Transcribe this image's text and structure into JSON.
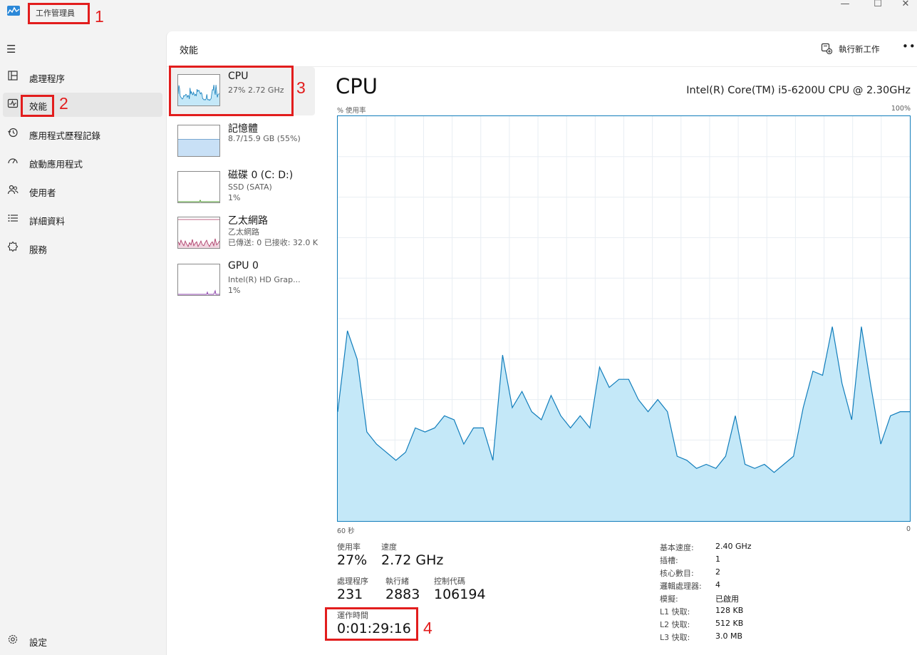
{
  "app": {
    "title": "工作管理員"
  },
  "window_controls": {
    "minimize": "—",
    "maximize": "☐",
    "close": "✕"
  },
  "nav": {
    "items": [
      {
        "label": "處理程序",
        "icon": "processes-icon",
        "active": false
      },
      {
        "label": "效能",
        "icon": "performance-icon",
        "active": true
      },
      {
        "label": "應用程式歷程記錄",
        "icon": "app-history-icon",
        "active": false
      },
      {
        "label": "啟動應用程式",
        "icon": "startup-apps-icon",
        "active": false
      },
      {
        "label": "使用者",
        "icon": "users-icon",
        "active": false
      },
      {
        "label": "詳細資料",
        "icon": "details-icon",
        "active": false
      },
      {
        "label": "服務",
        "icon": "services-icon",
        "active": false
      }
    ],
    "settings_label": "設定"
  },
  "header": {
    "title": "效能",
    "run_new_task": "執行新工作",
    "more": "•••"
  },
  "resources": [
    {
      "name": "CPU",
      "sub1": "27%  2.72 GHz",
      "sub2": "",
      "active": true
    },
    {
      "name": "記憶體",
      "sub1": "8.7/15.9 GB (55%)",
      "sub2": "",
      "active": false,
      "fill_level": 0.55
    },
    {
      "name": "磁碟 0 (C: D:)",
      "sub1": "SSD (SATA)",
      "sub2": "1%",
      "active": false
    },
    {
      "name": "乙太網路",
      "sub1": "乙太網路",
      "sub2": "已傳送: 0 已接收: 32.0 K",
      "active": false
    },
    {
      "name": "GPU 0",
      "sub1": "Intel(R) HD Grap...",
      "sub2": "1%",
      "active": false
    }
  ],
  "cpu": {
    "title": "CPU",
    "model": "Intel(R) Core(TM) i5-6200U CPU @ 2.30GHz",
    "graph_ylabel": "% 使用率",
    "graph_ymax": "100%",
    "graph_xleft": "60 秒",
    "graph_xright": "0",
    "stats": {
      "utilization_label": "使用率",
      "utilization": "27%",
      "speed_label": "速度",
      "speed": "2.72 GHz",
      "processes_label": "處理程序",
      "processes": "231",
      "threads_label": "執行緒",
      "threads": "2883",
      "handles_label": "控制代碼",
      "handles": "106194",
      "uptime_label": "運作時間",
      "uptime": "0:01:29:16"
    },
    "specs": [
      {
        "label": "基本速度:",
        "value": "2.40 GHz"
      },
      {
        "label": "插槽:",
        "value": "1"
      },
      {
        "label": "核心數目:",
        "value": "2"
      },
      {
        "label": "邏輯處理器:",
        "value": "4"
      },
      {
        "label": "模擬:",
        "value": "已啟用"
      },
      {
        "label": "L1 快取:",
        "value": "128 KB"
      },
      {
        "label": "L2 快取:",
        "value": "512 KB"
      },
      {
        "label": "L3 快取:",
        "value": "3.0 MB"
      }
    ]
  },
  "chart_data": {
    "type": "area",
    "ylabel": "% 使用率",
    "ylim": [
      0,
      100
    ],
    "xlim": [
      60,
      0
    ],
    "x_tick_labels": [
      "60 秒",
      "0"
    ],
    "grid": true,
    "color": "#117dbb",
    "fill": "#c4e8f8",
    "values": [
      27,
      47,
      40,
      22,
      19,
      17,
      15,
      17,
      23,
      22,
      23,
      26,
      25,
      19,
      23,
      23,
      15,
      41,
      28,
      32,
      27,
      25,
      31,
      26,
      23,
      26,
      23,
      38,
      33,
      35,
      35,
      30,
      27,
      30,
      27,
      16,
      15,
      13,
      14,
      13,
      16,
      26,
      14,
      13,
      14,
      12,
      14,
      16,
      28,
      37,
      36,
      48,
      34,
      25,
      48,
      33,
      19,
      26,
      27,
      27
    ]
  },
  "annotations": [
    "1",
    "2",
    "3",
    "4"
  ]
}
